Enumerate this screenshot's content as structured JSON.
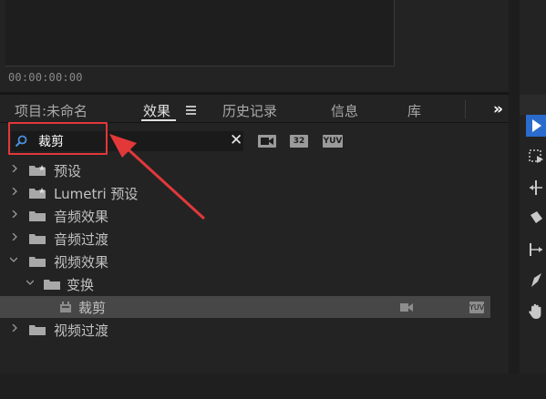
{
  "preview": {
    "timecode": "00:00:00:00"
  },
  "tabs": [
    {
      "label": "项目:未命名",
      "active": false
    },
    {
      "label": "效果",
      "active": true
    },
    {
      "label": "历史记录",
      "active": false
    },
    {
      "label": "信息",
      "active": false
    },
    {
      "label": "库",
      "active": false
    }
  ],
  "tab_overflow": "»",
  "search": {
    "value": "裁剪",
    "clear": "✕"
  },
  "filter_buttons": [
    {
      "icon": "accelerated-effects-icon",
      "label": ""
    },
    {
      "icon": "32-bit-color-icon",
      "label": "32"
    },
    {
      "icon": "yuv-effects-icon",
      "label": "YUV"
    }
  ],
  "tree": [
    {
      "label": "预设",
      "type": "special-folder",
      "expanded": false
    },
    {
      "label": "Lumetri 预设",
      "type": "special-folder",
      "expanded": false
    },
    {
      "label": "音频效果",
      "type": "folder",
      "expanded": false
    },
    {
      "label": "音频过渡",
      "type": "folder",
      "expanded": false
    },
    {
      "label": "视频效果",
      "type": "folder",
      "expanded": true
    },
    {
      "label": "变换",
      "type": "folder",
      "expanded": true
    },
    {
      "label": "裁剪",
      "type": "effect",
      "selected": true,
      "badges": [
        "accelerated",
        "YUV"
      ]
    },
    {
      "label": "视频过渡",
      "type": "folder",
      "expanded": false
    }
  ],
  "tools": [
    "selection-tool-icon",
    "track-select-icon",
    "ripple-edit-icon",
    "razor-icon",
    "slip-icon",
    "pen-icon",
    "hand-icon"
  ],
  "colors": {
    "highlight": "#e2383a",
    "accent": "#2b6bcc",
    "search_icon": "#4a90e2"
  }
}
